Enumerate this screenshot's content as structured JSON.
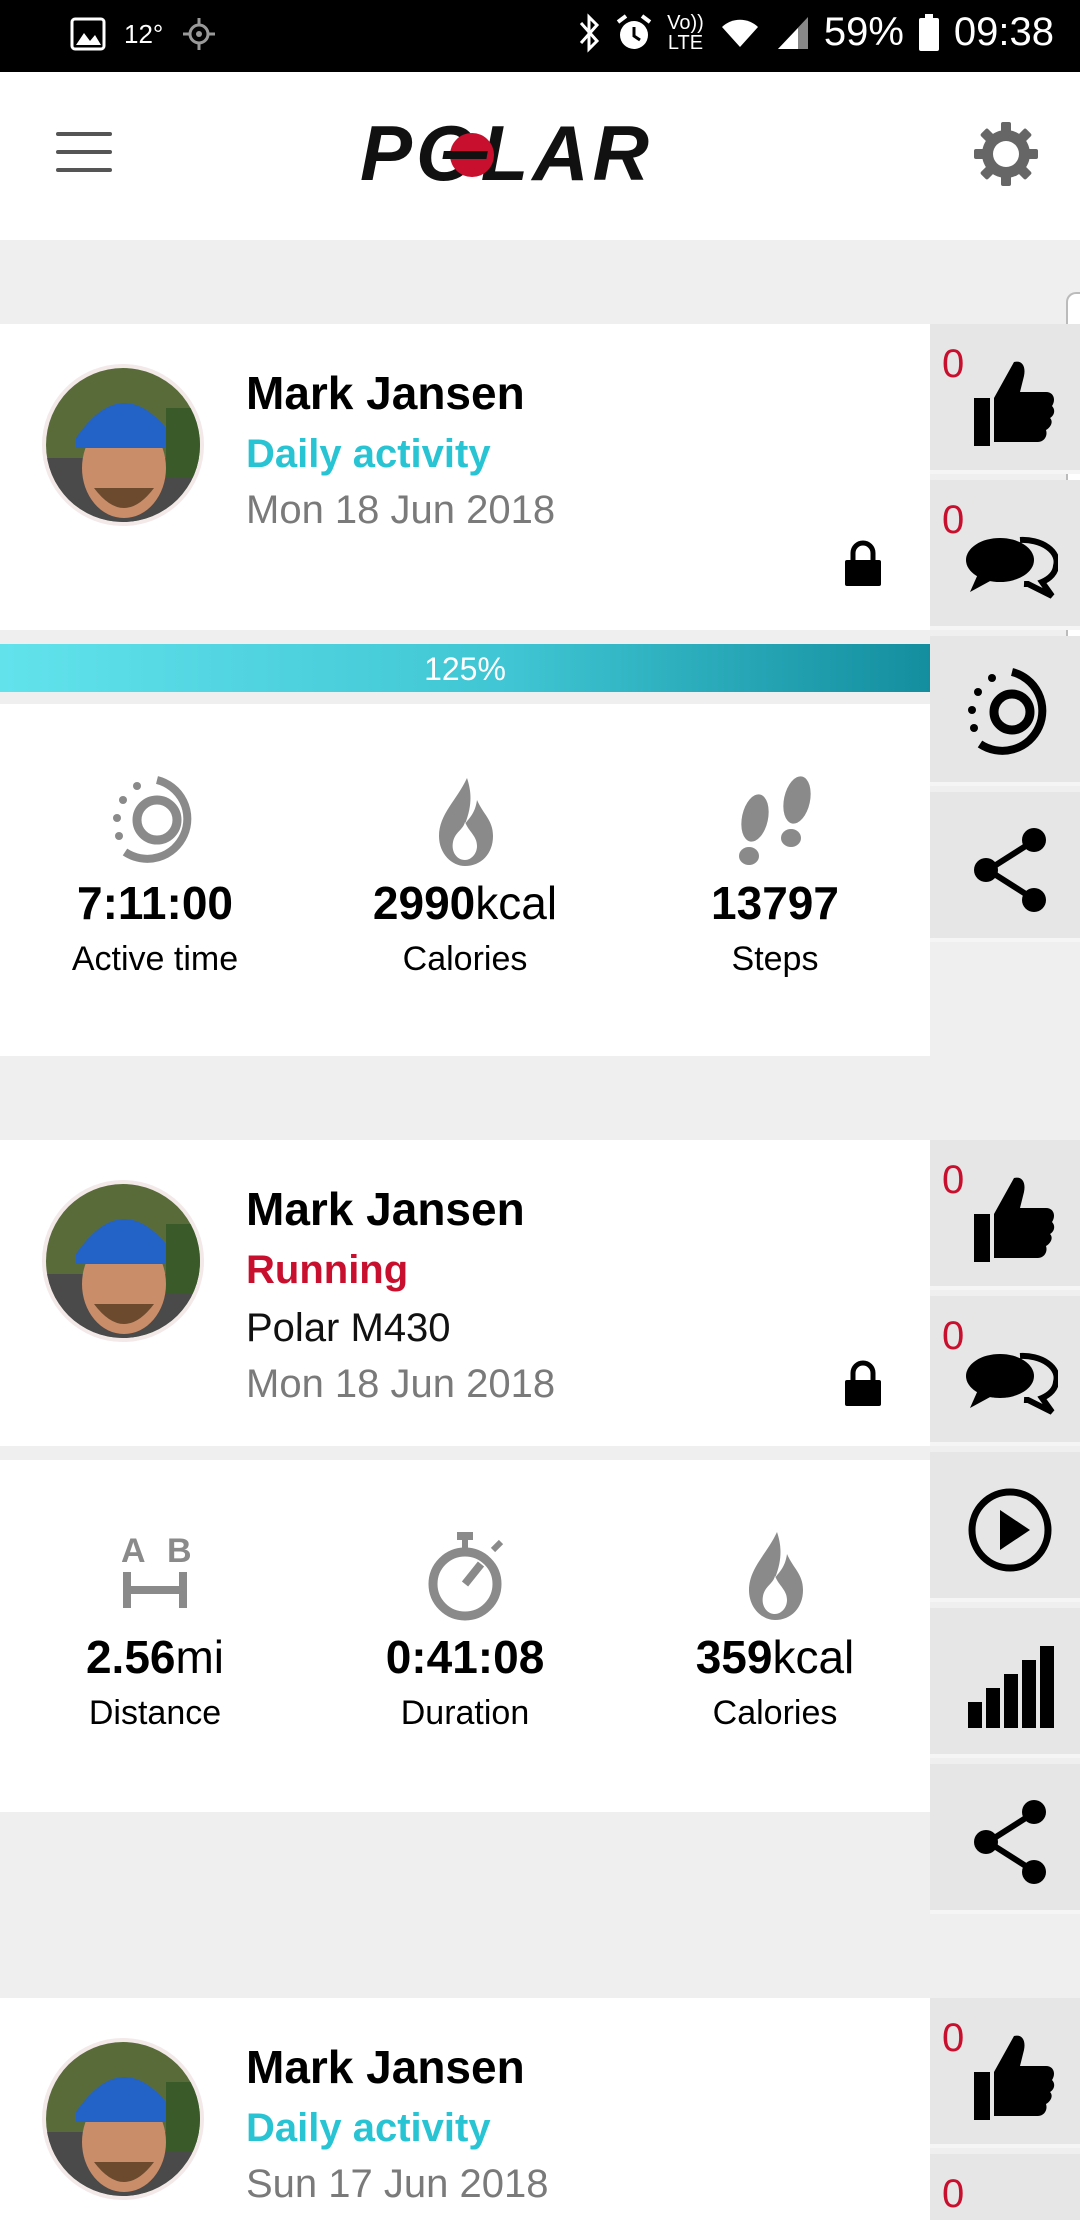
{
  "status_bar": {
    "temperature": "12°",
    "volte_line1": "Vo))",
    "volte_line2": "LTE",
    "battery": "59%",
    "time": "09:38"
  },
  "app": {
    "brand": "POLAR",
    "accent_red": "#c8102e",
    "accent_cyan": "#29c4d4"
  },
  "feed": [
    {
      "user": "Mark Jansen",
      "type": "Daily activity",
      "date": "Mon 18 Jun 2018",
      "progress": "125%",
      "likes": "0",
      "comments": "0",
      "stats": [
        {
          "value": "7:11:00",
          "unit": "",
          "label": "Active time",
          "icon": "activity-ring-icon"
        },
        {
          "value": "2990",
          "unit": "kcal",
          "label": "Calories",
          "icon": "flame-icon"
        },
        {
          "value": "13797",
          "unit": "",
          "label": "Steps",
          "icon": "footsteps-icon"
        }
      ]
    },
    {
      "user": "Mark Jansen",
      "type": "Running",
      "device": "Polar M430",
      "date": "Mon 18 Jun 2018",
      "likes": "0",
      "comments": "0",
      "stats": [
        {
          "value": "2.56",
          "unit": "mi",
          "label": "Distance",
          "icon": "distance-ab-icon"
        },
        {
          "value": "0:41:08",
          "unit": "",
          "label": "Duration",
          "icon": "stopwatch-icon"
        },
        {
          "value": "359",
          "unit": "kcal",
          "label": "Calories",
          "icon": "flame-icon"
        }
      ]
    },
    {
      "user": "Mark Jansen",
      "type": "Daily activity",
      "date": "Sun 17 Jun 2018",
      "likes": "0",
      "comments": "0"
    }
  ]
}
